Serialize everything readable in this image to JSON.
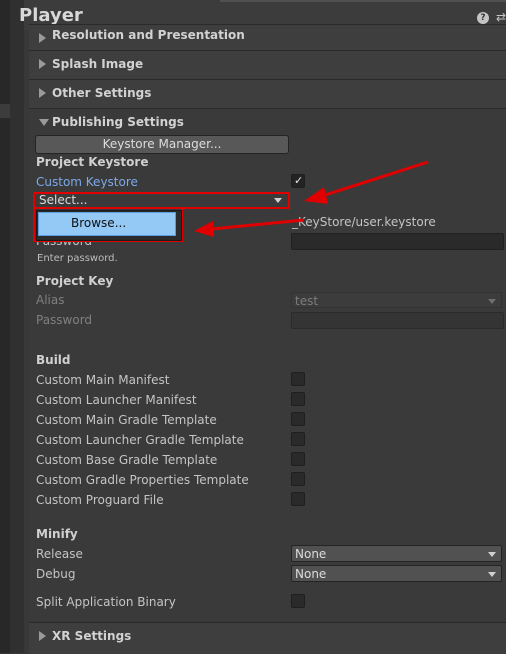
{
  "header": {
    "title": "Player",
    "help_icon": "?",
    "settings_icon": "⇄"
  },
  "sections": {
    "resolution": "Resolution and Presentation",
    "splash": "Splash Image",
    "other": "Other Settings",
    "publishing": "Publishing Settings",
    "xr": "XR Settings"
  },
  "publishing": {
    "keystore_manager_button": "Keystore Manager...",
    "project_keystore_heading": "Project Keystore",
    "custom_keystore_label": "Custom Keystore",
    "custom_keystore_checked": true,
    "select_dropdown_value": "Select...",
    "browse_item": "Browse...",
    "keystore_path": "_KeyStore/user.keystore",
    "password_label": "Password",
    "enter_password_hint": "Enter password.",
    "project_key_heading": "Project Key",
    "alias_label": "Alias",
    "alias_value": "test",
    "key_password_label": "Password",
    "build_heading": "Build",
    "build_items": [
      {
        "label": "Custom Main Manifest",
        "checked": false
      },
      {
        "label": "Custom Launcher Manifest",
        "checked": false
      },
      {
        "label": "Custom Main Gradle Template",
        "checked": false
      },
      {
        "label": "Custom Launcher Gradle Template",
        "checked": false
      },
      {
        "label": "Custom Base Gradle Template",
        "checked": false
      },
      {
        "label": "Custom Gradle Properties Template",
        "checked": false
      },
      {
        "label": "Custom Proguard File",
        "checked": false
      }
    ],
    "minify_heading": "Minify",
    "release_label": "Release",
    "release_value": "None",
    "debug_label": "Debug",
    "debug_value": "None",
    "split_binary_label": "Split Application Binary",
    "split_binary_checked": false
  },
  "colors": {
    "annotation_red": "#e00000",
    "highlight_blue": "#94c8f5",
    "link_blue": "#7da9e8"
  }
}
